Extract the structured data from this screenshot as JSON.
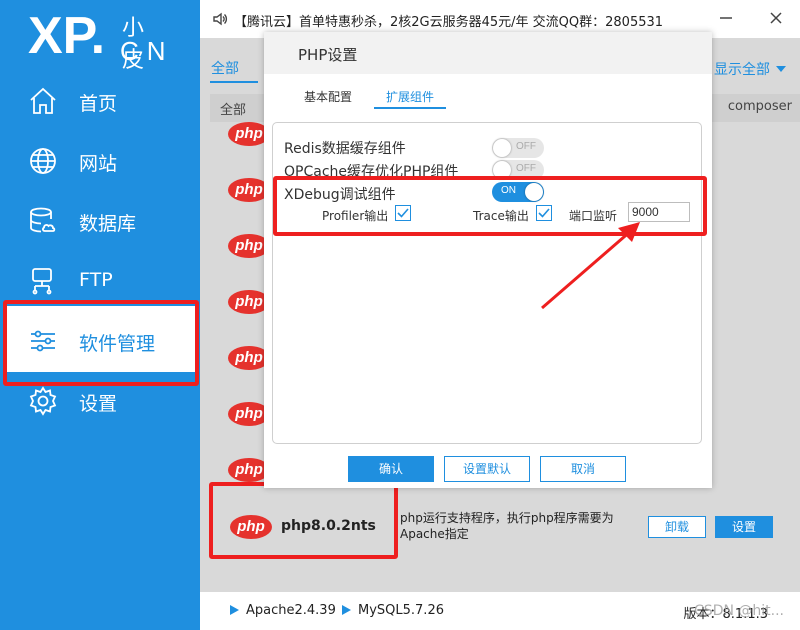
{
  "app": {
    "logo_main": "XP.",
    "logo_small": "小皮",
    "logo_cn": "CN"
  },
  "sidebar": {
    "items": [
      {
        "label": "首页",
        "icon": "home-icon"
      },
      {
        "label": "网站",
        "icon": "globe-icon"
      },
      {
        "label": "数据库",
        "icon": "database-icon"
      },
      {
        "label": "FTP",
        "icon": "ftp-icon"
      },
      {
        "label": "软件管理",
        "icon": "sliders-icon",
        "active": true
      },
      {
        "label": "设置",
        "icon": "gear-icon"
      }
    ]
  },
  "topbar": {
    "notice": "【腾讯云】首单特惠秒杀，2核2G云服务器45元/年 交流QQ群：2805531"
  },
  "main": {
    "tab_all": "全部",
    "show_all": "显示全部",
    "header_col1": "全部",
    "header_col_right": "composer",
    "php_logo_text": "php",
    "php_row": {
      "name": "php8.0.2nts",
      "desc": "php运行支持程序，执行php程序需要为Apache指定",
      "uninstall": "卸载",
      "setting": "设置"
    }
  },
  "bottom": {
    "apache": "Apache2.4.39",
    "mysql": "MySQL5.7.26",
    "version": "版本：8.1.1.3",
    "watermark": "CSDN @hit..."
  },
  "dialog": {
    "title": "PHP设置",
    "tabs": [
      "基本配置",
      "扩展组件"
    ],
    "active_tab": "扩展组件",
    "options": [
      {
        "label": "Redis数据缓存组件",
        "state": "OFF"
      },
      {
        "label": "OPCache缓存优化PHP组件",
        "state": "OFF"
      },
      {
        "label": "XDebug调试组件",
        "state": "ON"
      }
    ],
    "xdebug": {
      "profiler_label": "Profiler输出",
      "profiler_checked": true,
      "trace_label": "Trace输出",
      "trace_checked": true,
      "port_label": "端口监听",
      "port_value": "9000"
    },
    "buttons": {
      "confirm": "确认",
      "reset": "设置默认",
      "cancel": "取消"
    }
  },
  "colors": {
    "accent": "#1f8fdf",
    "highlight_red": "#ee1f1f",
    "php_red": "#e5322d"
  }
}
